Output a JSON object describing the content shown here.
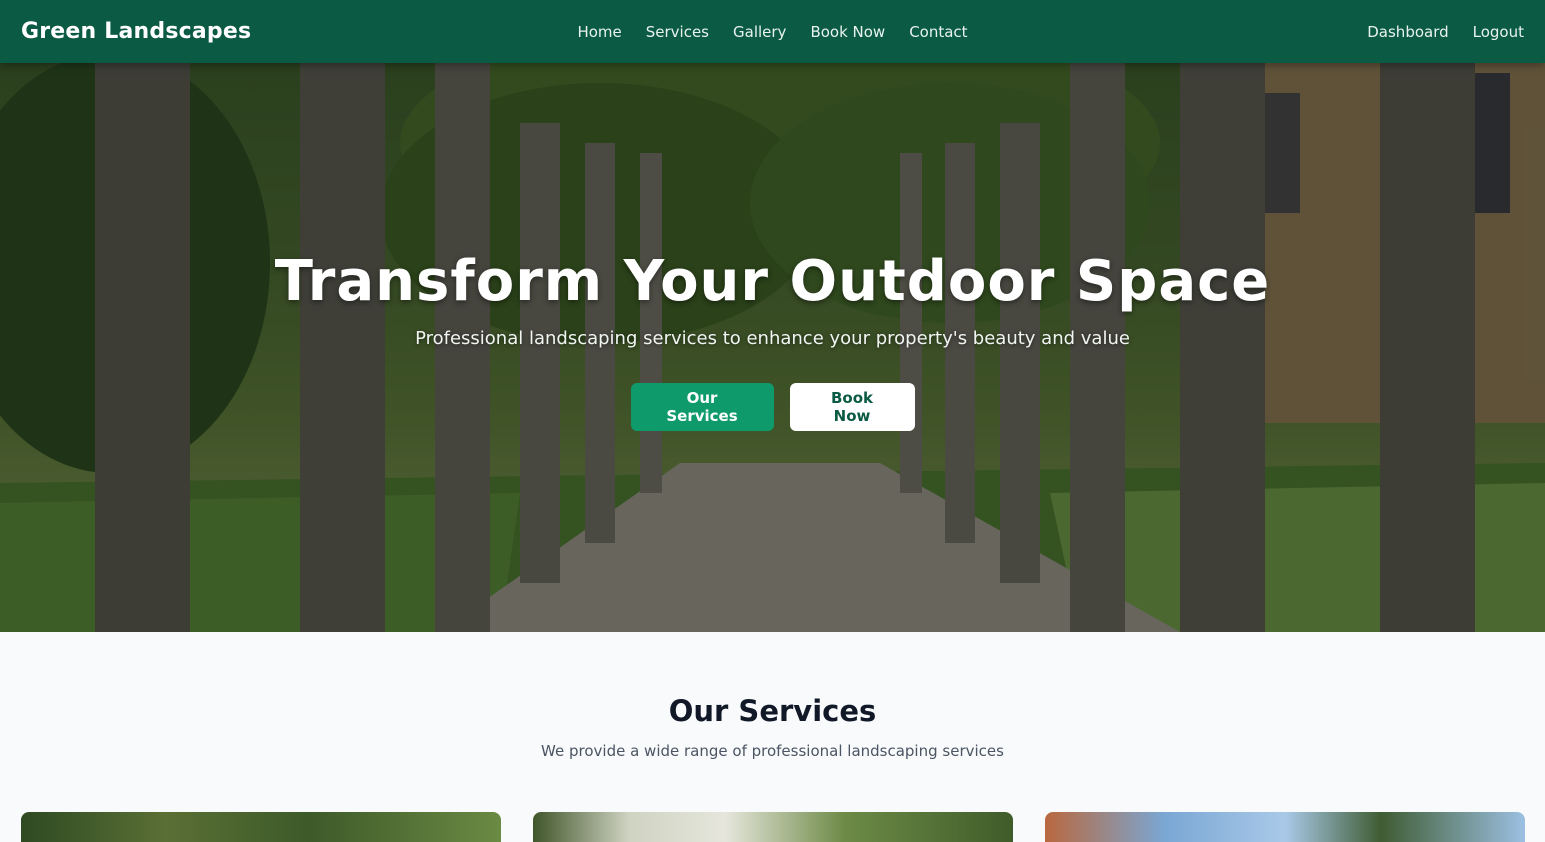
{
  "navbar": {
    "brand": "Green Landscapes",
    "links": [
      "Home",
      "Services",
      "Gallery",
      "Book Now",
      "Contact"
    ],
    "right_links": [
      "Dashboard",
      "Logout"
    ],
    "background_color": "#0b5a43"
  },
  "hero": {
    "title": "Transform Your Outdoor Space",
    "subtitle": "Professional landscaping services to enhance your property's beauty and value",
    "primary_button": "Our Services",
    "secondary_button": "Book Now",
    "primary_color": "#0e9a6b"
  },
  "services": {
    "title": "Our Services",
    "subtitle": "We provide a wide range of professional landscaping services"
  }
}
